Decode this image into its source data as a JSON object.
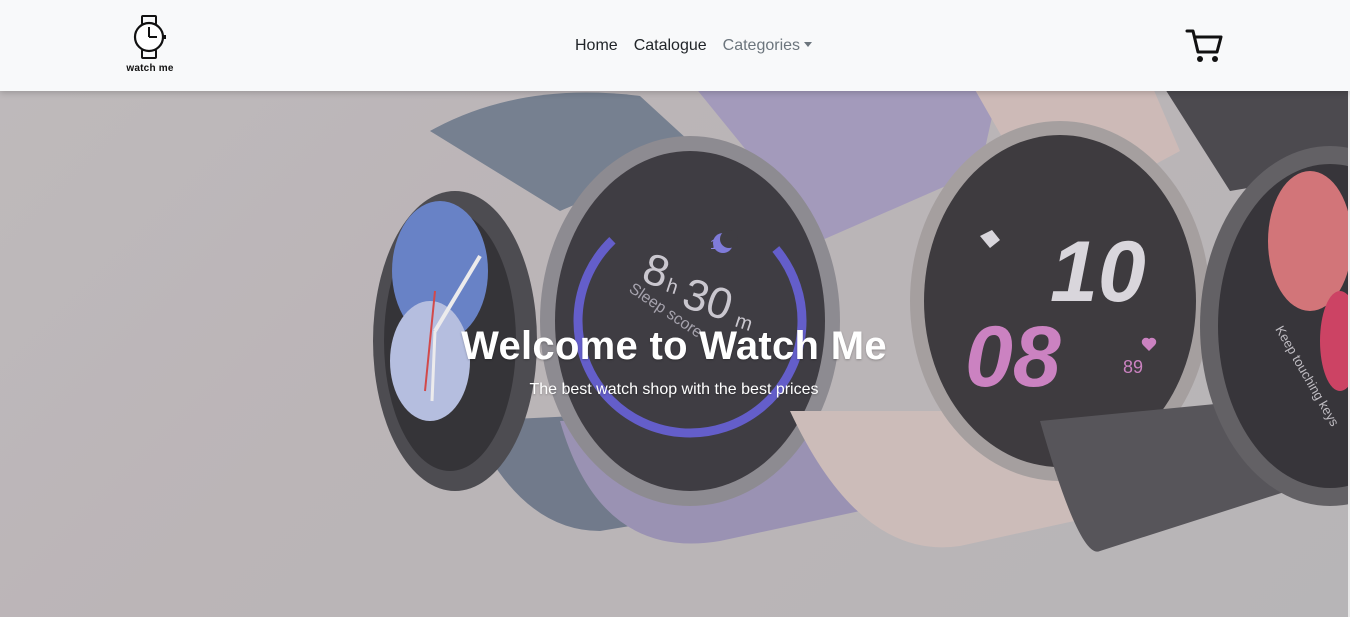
{
  "brand": {
    "name": "watch me",
    "logo_icon": "watch-icon"
  },
  "nav": {
    "items": [
      {
        "label": "Home"
      },
      {
        "label": "Catalogue"
      },
      {
        "label": "Categories"
      }
    ]
  },
  "cart": {
    "icon": "cart-icon"
  },
  "hero": {
    "title": "Welcome to Watch Me",
    "subtitle": "The best watch shop with the best prices",
    "image_subject": "smartwatches"
  },
  "watch_faces": {
    "sleep_hours": "8",
    "sleep_hours_unit": "h",
    "sleep_minutes": "30",
    "sleep_minutes_unit": "m",
    "sleep_label": "Sleep score",
    "sleep_marker": "12",
    "time_hours": "10",
    "time_minutes": "08",
    "heart_rate": "89",
    "side_label": "Keep touching keys"
  },
  "colors": {
    "navbar_bg": "#f8f9fa",
    "nav_text": "#212529",
    "nav_muted": "#6c757d",
    "hero_text": "#ffffff"
  }
}
